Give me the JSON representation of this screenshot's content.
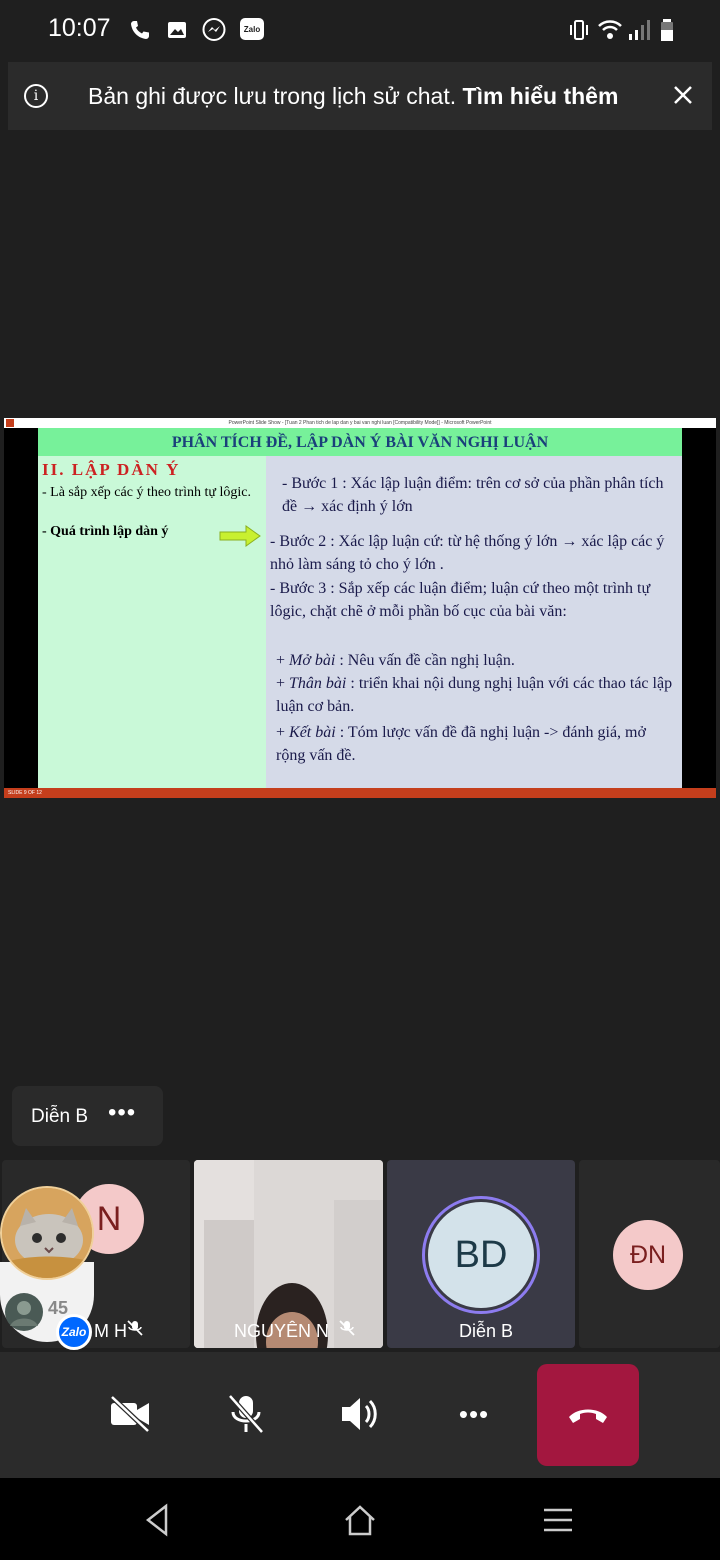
{
  "status_bar": {
    "time": "10:07",
    "zalo_badge": "Zalo",
    "icons": [
      "phone-icon",
      "gallery-icon",
      "messenger-icon",
      "zalo-icon",
      "vibrate-icon",
      "wifi-icon",
      "signal-icon",
      "battery-icon"
    ]
  },
  "banner": {
    "message": "Bản ghi được lưu trong lịch sử chat.",
    "link": "Tìm hiểu thêm"
  },
  "slide": {
    "window_title": "PowerPoint Slide Show - [Tuan 2 Phan tich de lap dan y bai van nghi luan [Compatibility Mode]] - Microsoft PowerPoint",
    "heading": "PHÂN TÍCH ĐỀ, LẬP DÀN Ý BÀI VĂN NGHỊ LUẬN",
    "section": "II. LẬP DÀN Ý",
    "left_line1": "- Là sắp xếp các ý theo trình tự lôgic.",
    "left_line2": "- Quá trình lập dàn ý",
    "step1": "- Bước 1 : Xác lập luận điểm: trên cơ sở của phần phân tích đề → xác định ý lớn",
    "step2": "- Bước 2 : Xác lập luận cứ: từ hệ thống ý lớn → xác lập các ý nhỏ làm sáng tỏ cho ý lớn .",
    "step3": "- Bước 3 : Sắp xếp các luận điểm; luận cứ theo một trình tự lôgic, chặt chẽ ở mỗi phần bố cục của bài văn:",
    "mo_bai_label": "Mở bài",
    "mo_bai_text": " : Nêu vấn đề cần nghị luận.",
    "than_bai_label": "Thân bài",
    "than_bai_text": " : triển khai nội dung nghị luận với các thao tác lập luận cơ bản.",
    "ket_bai_label": "Kết bài",
    "ket_bai_text": "  : Tóm lược vấn đề đã nghị luận -> đánh giá, mở rộng vấn đề.",
    "slide_counter": "SLIDE 9 OF 12"
  },
  "name_chip": {
    "name": "Diễn B",
    "more": "•••"
  },
  "participants": [
    {
      "initials": "N",
      "label": "M H",
      "color": "#f4c9c9"
    },
    {
      "initials": "",
      "label": "NGUYÊN N",
      "color": "#d8d4d2"
    },
    {
      "initials": "BD",
      "label": "Diễn B",
      "color": "#d3e2ea"
    },
    {
      "initials": "ĐN",
      "label": "",
      "color": "#f4c9c9"
    }
  ],
  "bubble": {
    "count": "45",
    "logo": "Zalo"
  },
  "controls": {
    "buttons": [
      "camera-off-icon",
      "mic-off-icon",
      "speaker-icon",
      "more-icon",
      "end-call-icon"
    ],
    "more_label": "•••"
  },
  "colors": {
    "end_call": "#a3173f",
    "slide_header": "#77f19a",
    "slide_left_bg": "#c9f9d8",
    "slide_right_bg": "#d5dae8",
    "section_red": "#cc2222",
    "speaking_ring": "#8d7cf0"
  }
}
